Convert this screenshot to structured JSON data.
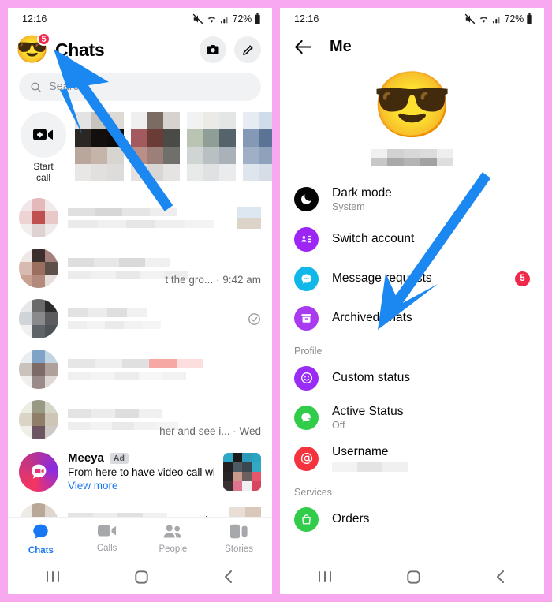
{
  "theme": {
    "border_pink": "#f7a8ef",
    "accent_blue": "#1877f2",
    "badge_red": "#f02849",
    "arrow_blue": "#1b87f0"
  },
  "left_phone": {
    "status_bar": {
      "time": "12:16",
      "battery": "72%",
      "icons": [
        "mute-icon",
        "wifi-icon",
        "signal-icon",
        "battery-icon"
      ]
    },
    "header": {
      "title": "Chats",
      "avatar_emoji": "😎",
      "avatar_badge": "5",
      "camera_icon": "camera-icon",
      "compose_icon": "pencil-icon"
    },
    "search": {
      "placeholder": "Search",
      "icon": "search-icon"
    },
    "calls_strip": {
      "start_call_line1": "Start",
      "start_call_line2": "call",
      "icon": "video-plus-icon"
    },
    "chat_rows": [
      {
        "snippet": "",
        "meta": ""
      },
      {
        "snippet": "t the gro...",
        "meta": "9:42 am"
      },
      {
        "snippet": "",
        "meta": "",
        "seen": true
      },
      {
        "snippet": "",
        "meta": ""
      },
      {
        "snippet": "her and see i...",
        "meta": "Wed"
      }
    ],
    "ad": {
      "name": "Meeya",
      "badge": "Ad",
      "text": "From here to have video call with...",
      "cta": "View more"
    },
    "last_row": {
      "name": "Mendoza",
      "meta": "u · Wed"
    },
    "bottom_nav": [
      {
        "label": "Chats",
        "icon": "chat-bubble-icon",
        "active": true
      },
      {
        "label": "Calls",
        "icon": "video-camera-icon",
        "active": false
      },
      {
        "label": "People",
        "icon": "people-icon",
        "active": false
      },
      {
        "label": "Stories",
        "icon": "stories-icon",
        "active": false
      }
    ],
    "system_nav": [
      "recents-icon",
      "home-icon",
      "back-icon"
    ]
  },
  "right_phone": {
    "status_bar": {
      "time": "12:16",
      "battery": "72%",
      "icons": [
        "mute-icon",
        "wifi-icon",
        "signal-icon",
        "battery-icon"
      ]
    },
    "header": {
      "title": "Me",
      "back_icon": "back-arrow-icon"
    },
    "profile": {
      "avatar_emoji": "😎",
      "name_hidden": true
    },
    "menu_items": [
      {
        "label": "Dark mode",
        "sub": "System",
        "icon": "moon-icon",
        "color": "#050505",
        "badge": ""
      },
      {
        "label": "Switch account",
        "sub": "",
        "icon": "switch-account-icon",
        "color": "#9d26f5",
        "badge": ""
      },
      {
        "label": "Message requests",
        "sub": "",
        "icon": "message-bubble-icon",
        "color": "#0fb8e8",
        "badge": "5"
      },
      {
        "label": "Archived chats",
        "sub": "",
        "icon": "archive-box-icon",
        "color": "#a83af0",
        "badge": ""
      }
    ],
    "sections": [
      {
        "header": "Profile",
        "items": [
          {
            "label": "Custom status",
            "sub": "",
            "icon": "smiley-icon",
            "color": "#9a2df5",
            "badge": ""
          },
          {
            "label": "Active Status",
            "sub": "Off",
            "icon": "active-status-icon",
            "color": "#31cd4a",
            "badge": ""
          },
          {
            "label": "Username",
            "sub": "",
            "icon": "at-sign-icon",
            "color": "#f5333f",
            "badge": "",
            "value_hidden": true
          }
        ]
      },
      {
        "header": "Services",
        "items": [
          {
            "label": "Orders",
            "sub": "",
            "icon": "shopping-bag-icon",
            "color": "#31cd4a",
            "badge": ""
          }
        ]
      }
    ],
    "system_nav": [
      "recents-icon",
      "home-icon",
      "back-icon"
    ]
  }
}
